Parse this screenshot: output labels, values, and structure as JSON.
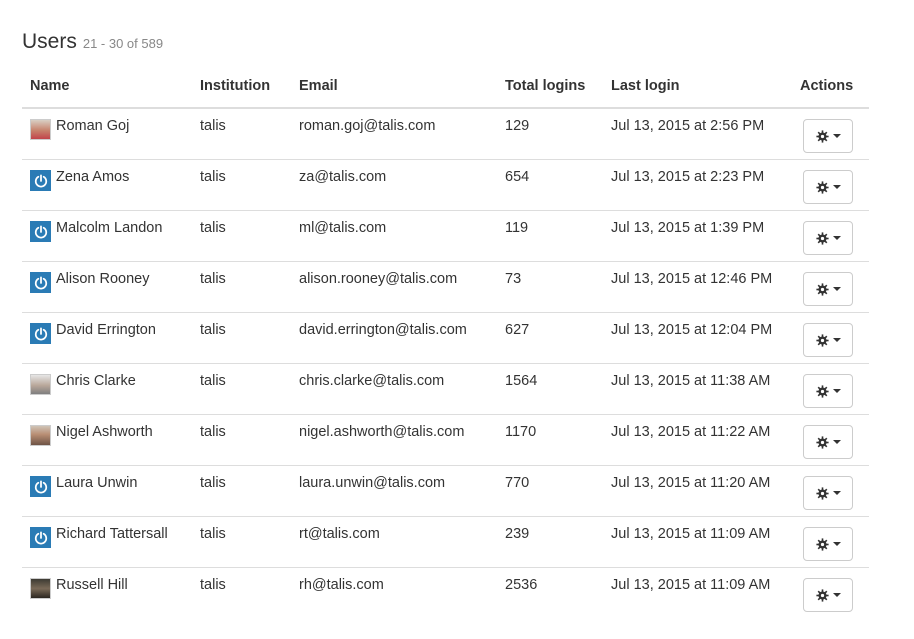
{
  "header": {
    "title": "Users",
    "range": "21 - 30 of 589"
  },
  "columns": [
    "Name",
    "Institution",
    "Email",
    "Total logins",
    "Last login",
    "Actions"
  ],
  "icons": {
    "brand_avatar": "power-icon",
    "action": "gear-icon",
    "caret": "caret-down-icon"
  },
  "colors": {
    "brand_avatar": "#2a7bb5",
    "border": "#dddddd",
    "muted": "#888888"
  },
  "rows": [
    {
      "name": "Roman Goj",
      "avatar": "photo-red",
      "institution": "talis",
      "email": "roman.goj@talis.com",
      "logins": "129",
      "last_login": "Jul 13, 2015 at 2:56 PM"
    },
    {
      "name": "Zena Amos",
      "avatar": "brand",
      "institution": "talis",
      "email": "za@talis.com",
      "logins": "654",
      "last_login": "Jul 13, 2015 at 2:23 PM"
    },
    {
      "name": "Malcolm Landon",
      "avatar": "brand",
      "institution": "talis",
      "email": "ml@talis.com",
      "logins": "119",
      "last_login": "Jul 13, 2015 at 1:39 PM"
    },
    {
      "name": "Alison Rooney",
      "avatar": "brand",
      "institution": "talis",
      "email": "alison.rooney@talis.com",
      "logins": "73",
      "last_login": "Jul 13, 2015 at 12:46 PM"
    },
    {
      "name": "David Errington",
      "avatar": "brand",
      "institution": "talis",
      "email": "david.errington@talis.com",
      "logins": "627",
      "last_login": "Jul 13, 2015 at 12:04 PM"
    },
    {
      "name": "Chris Clarke",
      "avatar": "photo-grey",
      "institution": "talis",
      "email": "chris.clarke@talis.com",
      "logins": "1564",
      "last_login": "Jul 13, 2015 at 11:38 AM"
    },
    {
      "name": "Nigel Ashworth",
      "avatar": "photo",
      "institution": "talis",
      "email": "nigel.ashworth@talis.com",
      "logins": "1170",
      "last_login": "Jul 13, 2015 at 11:22 AM"
    },
    {
      "name": "Laura Unwin",
      "avatar": "brand",
      "institution": "talis",
      "email": "laura.unwin@talis.com",
      "logins": "770",
      "last_login": "Jul 13, 2015 at 11:20 AM"
    },
    {
      "name": "Richard Tattersall",
      "avatar": "brand",
      "institution": "talis",
      "email": "rt@talis.com",
      "logins": "239",
      "last_login": "Jul 13, 2015 at 11:09 AM"
    },
    {
      "name": "Russell Hill",
      "avatar": "photo-dark",
      "institution": "talis",
      "email": "rh@talis.com",
      "logins": "2536",
      "last_login": "Jul 13, 2015 at 11:09 AM"
    }
  ]
}
